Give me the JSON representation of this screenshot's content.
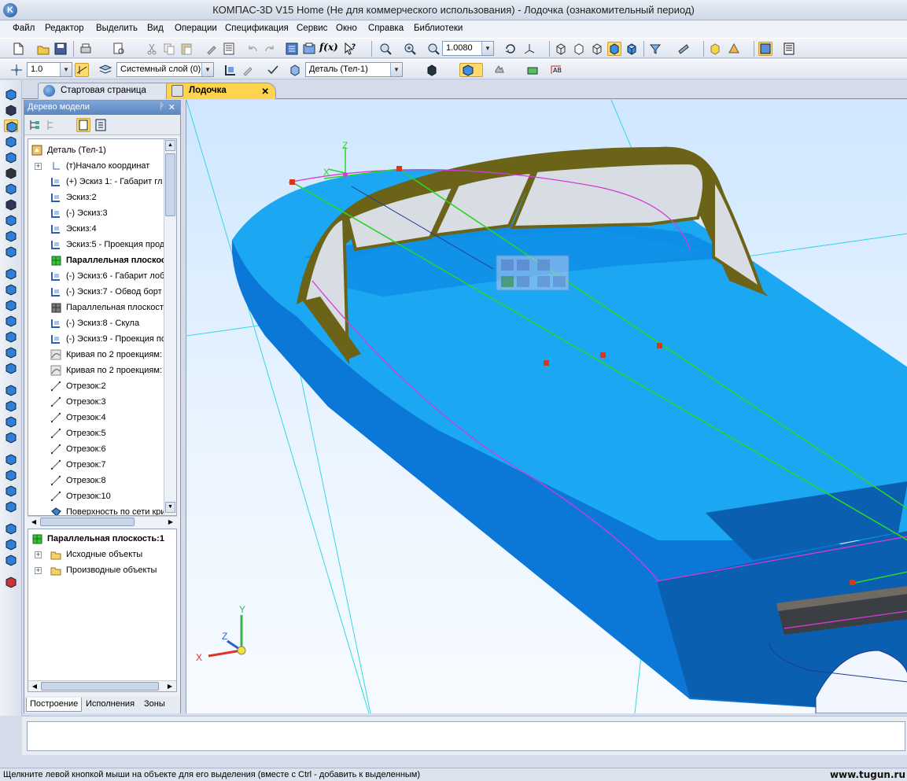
{
  "window": {
    "logo": "K",
    "title": "КОМПАС-3D V15 Home (Не для коммерческого использования) - Лодочка (ознакомительный период)"
  },
  "menu": [
    "Файл",
    "Редактор",
    "Выделить",
    "Вид",
    "Операции",
    "Спецификация",
    "Сервис",
    "Окно",
    "Справка",
    "Библиотеки"
  ],
  "toolbar1": {
    "zoom_value": "1.0080"
  },
  "toolbar2": {
    "step_value": "1.0",
    "layer_value": "Системный слой (0)",
    "part_value": "Деталь (Тел-1)"
  },
  "doc_tabs": [
    {
      "label": "Стартовая страница",
      "active": false
    },
    {
      "label": "Лодочка",
      "active": true,
      "close": "✕"
    }
  ],
  "tree": {
    "header": "Дерево модели",
    "pin": "ᚹ",
    "close": "✕",
    "items": [
      {
        "label": "Деталь (Тел-1)",
        "bold": false,
        "icon": "part-icon",
        "indent": 0,
        "expander": ""
      },
      {
        "label": "(т)Начало координат",
        "bold": false,
        "icon": "origin-icon",
        "indent": 1,
        "expander": "+"
      },
      {
        "label": "(+) Эскиз 1: - Габарит гл",
        "bold": false,
        "icon": "sketch-icon",
        "indent": 1,
        "expander": ""
      },
      {
        "label": "Эскиз:2",
        "bold": false,
        "icon": "sketch-icon",
        "indent": 1,
        "expander": ""
      },
      {
        "label": "(-) Эскиз:3",
        "bold": false,
        "icon": "sketch-icon",
        "indent": 1,
        "expander": ""
      },
      {
        "label": "Эскиз:4",
        "bold": false,
        "icon": "sketch-icon",
        "indent": 1,
        "expander": ""
      },
      {
        "label": "Эскиз:5 - Проекция прод",
        "bold": false,
        "icon": "sketch-icon",
        "indent": 1,
        "expander": ""
      },
      {
        "label": "Параллельная плоскость",
        "bold": true,
        "icon": "plane-green-icon",
        "indent": 1,
        "expander": ""
      },
      {
        "label": "(-) Эскиз:6 - Габарит лоб",
        "bold": false,
        "icon": "sketch-icon",
        "indent": 1,
        "expander": ""
      },
      {
        "label": "(-) Эскиз:7 - Обвод борт",
        "bold": false,
        "icon": "sketch-icon",
        "indent": 1,
        "expander": ""
      },
      {
        "label": "Параллельная плоскость",
        "bold": false,
        "icon": "plane-gray-icon",
        "indent": 1,
        "expander": ""
      },
      {
        "label": "(-) Эскиз:8 - Скула",
        "bold": false,
        "icon": "sketch-icon",
        "indent": 1,
        "expander": ""
      },
      {
        "label": "(-) Эскиз:9 - Проекция по",
        "bold": false,
        "icon": "sketch-icon",
        "indent": 1,
        "expander": ""
      },
      {
        "label": "Кривая по 2 проекциям:",
        "bold": false,
        "icon": "curve-icon",
        "indent": 1,
        "expander": ""
      },
      {
        "label": "Кривая по 2 проекциям:",
        "bold": false,
        "icon": "curve-icon",
        "indent": 1,
        "expander": ""
      },
      {
        "label": "Отрезок:2",
        "bold": false,
        "icon": "segment-icon",
        "indent": 1,
        "expander": ""
      },
      {
        "label": "Отрезок:3",
        "bold": false,
        "icon": "segment-icon",
        "indent": 1,
        "expander": ""
      },
      {
        "label": "Отрезок:4",
        "bold": false,
        "icon": "segment-icon",
        "indent": 1,
        "expander": ""
      },
      {
        "label": "Отрезок:5",
        "bold": false,
        "icon": "segment-icon",
        "indent": 1,
        "expander": ""
      },
      {
        "label": "Отрезок:6",
        "bold": false,
        "icon": "segment-icon",
        "indent": 1,
        "expander": ""
      },
      {
        "label": "Отрезок:7",
        "bold": false,
        "icon": "segment-icon",
        "indent": 1,
        "expander": ""
      },
      {
        "label": "Отрезок:8",
        "bold": false,
        "icon": "segment-icon",
        "indent": 1,
        "expander": ""
      },
      {
        "label": "Отрезок:10",
        "bold": false,
        "icon": "segment-icon",
        "indent": 1,
        "expander": ""
      },
      {
        "label": "Поверхность по сети кри",
        "bold": false,
        "icon": "surface-icon",
        "indent": 1,
        "expander": ""
      }
    ],
    "lower": [
      {
        "label": "Параллельная плоскость:1",
        "bold": true,
        "icon": "plane-green-icon",
        "expander": ""
      },
      {
        "label": "Исходные объекты",
        "bold": false,
        "icon": "folder-icon",
        "expander": "+"
      },
      {
        "label": "Производные объекты",
        "bold": false,
        "icon": "folder-icon",
        "expander": "+"
      }
    ],
    "bottom_tabs": [
      "Построение",
      "Исполнения",
      "Зоны"
    ]
  },
  "viewport": {
    "axis_x": "X",
    "axis_y": "Y",
    "axis_z": "Z",
    "origin_x": "X",
    "origin_z": "Z"
  },
  "status": {
    "text": "Щелкните левой кнопкой мыши на объекте для его выделения (вместе с Ctrl - добавить к выделенным)",
    "watermark": "www.tugun.ru"
  },
  "colors": {
    "hull": "#1aa3f0",
    "hull_dark": "#0f79d6",
    "windshield_frame": "#6b6418",
    "sketch_green": "#2bd42b",
    "sketch_magenta": "#d53ad8",
    "construction_cyan": "#33d9e6",
    "point_red": "#d23a1c"
  }
}
